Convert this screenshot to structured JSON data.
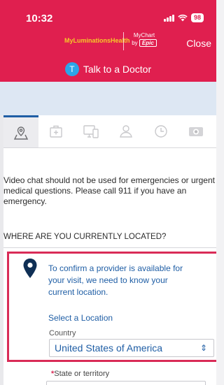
{
  "status_bar": {
    "time": "10:32",
    "battery": "98"
  },
  "header": {
    "brand": "MyLuminationsHealth",
    "mychart_top": "MyChart",
    "mychart_by": "by",
    "mychart_epic": "Epic",
    "close_label": "Close",
    "talk_badge": "T",
    "talk_label": "Talk to a Doctor"
  },
  "colors": {
    "header": "#e01f4f",
    "link": "#1f5ea5",
    "accent": "#d92b57",
    "band": "#dde7f3"
  },
  "icon_tabs": [
    "map-location-icon",
    "medical-kit-icon",
    "devices-icon",
    "person-icon",
    "clock-icon",
    "camera-icon"
  ],
  "disclaimer": "Video chat should not be used for emergencies or urgent medical questions.  Please call 911 if you have an emergency.",
  "section_title": "WHERE ARE YOU CURRENTLY LOCATED?",
  "location": {
    "message": "To confirm a provider is available for your visit, we need to know your current location.",
    "select_link": "Select a Location",
    "country_label": "Country",
    "country_value": "United States of America"
  },
  "state": {
    "required_mark": "*",
    "label": "State or territory"
  }
}
